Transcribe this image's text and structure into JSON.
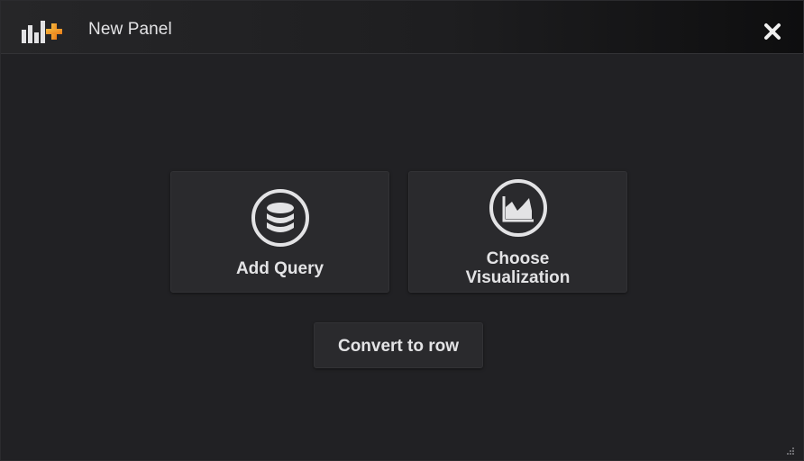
{
  "header": {
    "title": "New Panel",
    "icon": "add-panel-icon",
    "close_icon": "close-icon"
  },
  "actions": {
    "add_query": {
      "label": "Add Query",
      "icon": "database-icon"
    },
    "choose_visualization": {
      "label_line1": "Choose",
      "label_line2": "Visualization",
      "icon": "area-chart-icon"
    },
    "convert_to_row": {
      "label": "Convert to row"
    }
  },
  "colors": {
    "background": "#212124",
    "card": "#2a2a2d",
    "text": "#e3e3e5",
    "accent_orange": "#eb7b18",
    "accent_yellow": "#f5b93e"
  }
}
